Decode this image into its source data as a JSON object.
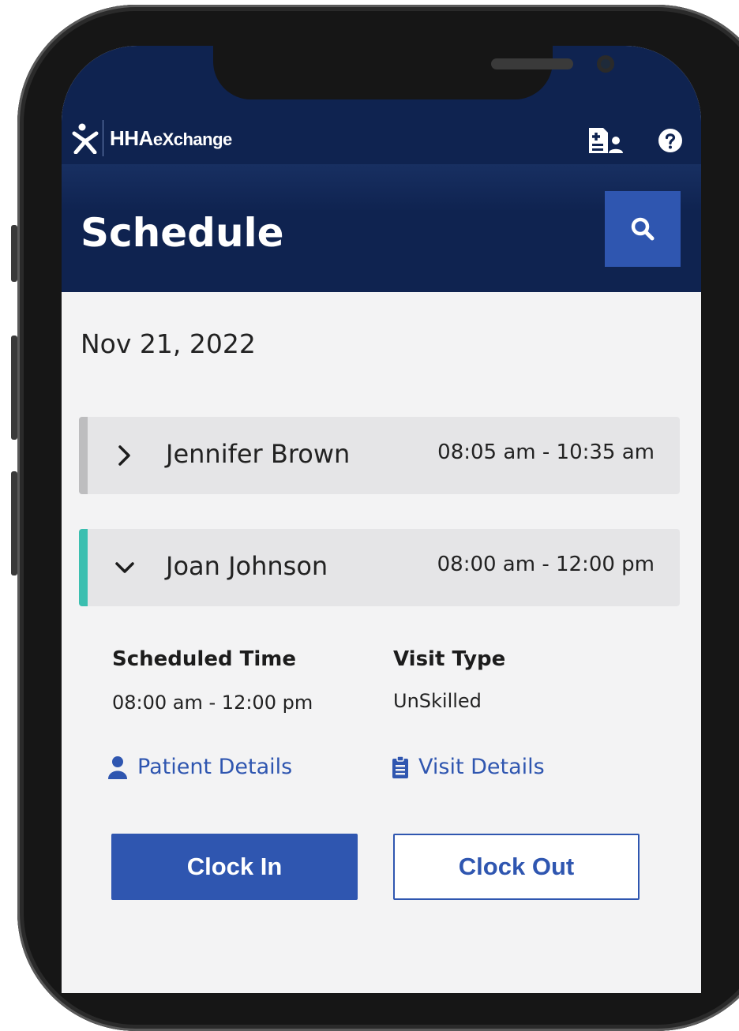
{
  "app": {
    "brand": "HHAeXchange",
    "brand_big": "HHA",
    "brand_small": "eXchange",
    "page_title": "Schedule"
  },
  "header": {
    "icons": [
      "patient-profile-icon",
      "help-icon",
      "search-icon"
    ]
  },
  "schedule": {
    "date": "Nov 21, 2022",
    "visits": [
      {
        "name": "Jennifer Brown",
        "time": "08:05 am - 10:35 am",
        "expanded": false
      },
      {
        "name": "Joan Johnson",
        "time": "08:00 am - 12:00 pm",
        "expanded": true
      }
    ]
  },
  "visit_detail": {
    "scheduled_time_label": "Scheduled Time",
    "scheduled_time_value": "08:00 am - 12:00 pm",
    "visit_type_label": "Visit Type",
    "visit_type_value": "UnSkilled",
    "patient_details_link": "Patient Details",
    "visit_details_link": "Visit Details",
    "clock_in_label": "Clock In",
    "clock_out_label": "Clock Out"
  },
  "colors": {
    "header_bg": "#0f2350",
    "primary": "#2f56b0",
    "expanded_accent": "#3bbfb0",
    "collapsed_accent": "#bdbdbf",
    "row_bg": "#e5e5e7",
    "screen_bg": "#f3f3f4"
  }
}
